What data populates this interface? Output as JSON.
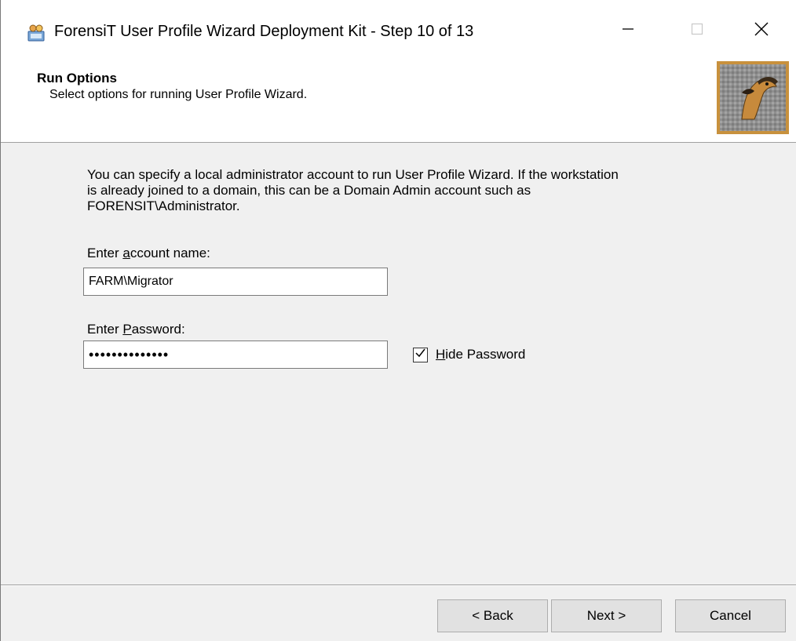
{
  "window": {
    "title": "ForensiT User Profile Wizard Deployment Kit - Step 10 of 13",
    "app_icon": "profile-wizard-app-icon",
    "controls": {
      "minimize_icon": "minimize-icon",
      "maximize_icon": "maximize-icon",
      "close_icon": "close-icon"
    }
  },
  "header": {
    "title": "Run Options",
    "subtitle": "Select options for running User Profile Wizard.",
    "logo": "forensit-logo"
  },
  "body": {
    "instructions": "You can specify a local administrator account to run User Profile Wizard. If the workstation is already joined to a domain, this can be a Domain Admin account such as FORENSIT\\Administrator.",
    "account_label_pre": "Enter ",
    "account_label_accel": "a",
    "account_label_post": "ccount name:",
    "account_value": "FARM\\Migrator",
    "password_label_pre": "Enter ",
    "password_label_accel": "P",
    "password_label_post": "assword:",
    "password_masked": "••••••••••••••",
    "hide_password_checked": true,
    "hide_password_accel": "H",
    "hide_password_rest": "ide Password"
  },
  "footer": {
    "back_label": "< Back",
    "next_label": "Next >",
    "cancel_label": "Cancel"
  },
  "colors": {
    "dialog_bg": "#f0f0f0",
    "header_bg": "#ffffff",
    "logo_frame": "#c8913d",
    "button_bg": "#e1e1e1"
  }
}
